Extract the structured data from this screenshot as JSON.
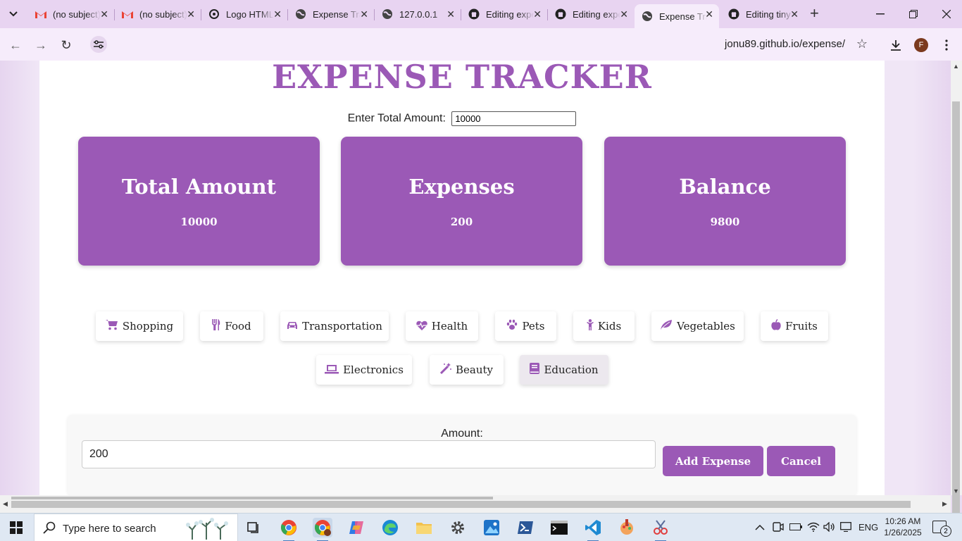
{
  "browser": {
    "tabs": [
      {
        "title": "(no subject)",
        "icon": "gmail-icon",
        "active": false
      },
      {
        "title": "(no subject)",
        "icon": "gmail-icon",
        "active": false
      },
      {
        "title": "Logo HTML",
        "icon": "openai-icon",
        "active": false
      },
      {
        "title": "Expense Tracker",
        "icon": "globe-icon",
        "active": false
      },
      {
        "title": "127.0.0.1",
        "icon": "globe-icon",
        "active": false
      },
      {
        "title": "Editing expense",
        "icon": "github-icon",
        "active": false
      },
      {
        "title": "Editing expense",
        "icon": "github-icon",
        "active": false
      },
      {
        "title": "Expense Tracker",
        "icon": "globe-icon",
        "active": true
      },
      {
        "title": "Editing tiny",
        "icon": "github-icon",
        "active": false
      }
    ],
    "url": "jonu89.github.io/expense/",
    "profile_initial": "F"
  },
  "page": {
    "title": "EXPENSE TRACKER",
    "total_label": "Enter Total Amount:",
    "total_value": "10000",
    "cards": [
      {
        "title": "Total Amount",
        "value": "10000"
      },
      {
        "title": "Expenses",
        "value": "200"
      },
      {
        "title": "Balance",
        "value": "9800"
      }
    ],
    "categories": [
      {
        "label": "Shopping",
        "icon": "cart-icon",
        "glyph": "🛒"
      },
      {
        "label": "Food",
        "icon": "utensils-icon",
        "glyph": "🍴"
      },
      {
        "label": "Transportation",
        "icon": "car-icon",
        "glyph": "🚘"
      },
      {
        "label": "Health",
        "icon": "heartbeat-icon",
        "glyph": "♥"
      },
      {
        "label": "Pets",
        "icon": "paw-icon",
        "glyph": "🐾"
      },
      {
        "label": "Kids",
        "icon": "child-icon",
        "glyph": "🚸"
      },
      {
        "label": "Vegetables",
        "icon": "leaf-icon",
        "glyph": "🍃"
      },
      {
        "label": "Fruits",
        "icon": "apple-icon",
        "glyph": "🍎"
      },
      {
        "label": "Electronics",
        "icon": "laptop-icon",
        "glyph": "💻"
      },
      {
        "label": "Beauty",
        "icon": "magic-wand-icon",
        "glyph": "🪄"
      },
      {
        "label": "Education",
        "icon": "book-icon",
        "glyph": "📕",
        "selected": true
      }
    ],
    "amount_label": "Amount:",
    "amount_value": "200",
    "add_button": "Add Expense",
    "cancel_button": "Cancel"
  },
  "taskbar": {
    "search_placeholder": "Type here to search",
    "language": "ENG",
    "time": "10:26 AM",
    "date": "1/26/2025",
    "notifications": "2"
  },
  "colors": {
    "accent": "#9b59b6",
    "chrome_frame": "#e8d4f1"
  }
}
